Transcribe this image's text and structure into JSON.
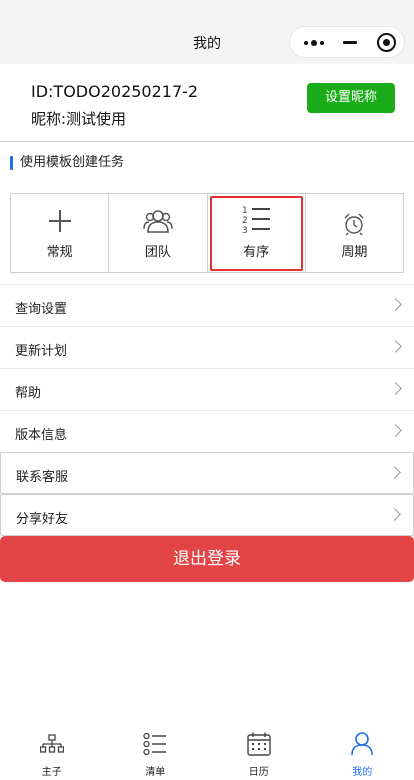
{
  "navbar": {
    "title": "我的"
  },
  "profile": {
    "id_text": "ID:TODO20250217-2",
    "nickname_text": "昵称:测试使用",
    "set_nickname_label": "设置昵称"
  },
  "templates": {
    "title": "使用模板创建任务",
    "items": [
      {
        "label": "常规",
        "icon": "plus-icon"
      },
      {
        "label": "团队",
        "icon": "team-icon"
      },
      {
        "label": "有序",
        "icon": "ordered-list-icon",
        "selected": true
      },
      {
        "label": "周期",
        "icon": "alarm-clock-icon"
      }
    ]
  },
  "menu": {
    "items": [
      {
        "label": "查询设置"
      },
      {
        "label": "更新计划"
      },
      {
        "label": "帮助"
      },
      {
        "label": "版本信息"
      },
      {
        "label": "联系客服"
      },
      {
        "label": "分享好友"
      }
    ]
  },
  "logout_label": "退出登录",
  "tabbar": {
    "active_color": "#1e6fe8",
    "items": [
      {
        "label": "主子",
        "icon": "hierarchy-icon"
      },
      {
        "label": "清单",
        "icon": "list-icon"
      },
      {
        "label": "日历",
        "icon": "calendar-icon"
      },
      {
        "label": "我的",
        "icon": "user-icon",
        "active": true
      }
    ]
  }
}
